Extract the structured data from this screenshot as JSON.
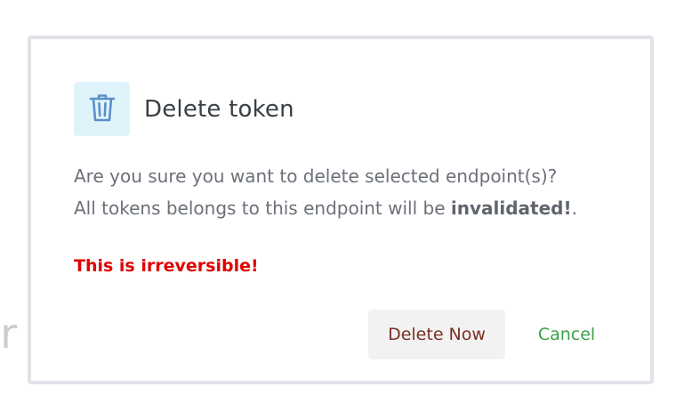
{
  "background": {
    "partial_text": "er"
  },
  "dialog": {
    "icon": "trash-icon",
    "title": "Delete token",
    "message_line1": "Are you sure you want to delete selected endpoint(s)?",
    "message_line2_prefix": "All tokens belongs to this endpoint will be ",
    "message_line2_bold": "invalidated!",
    "message_line2_suffix": ".",
    "warning": "This is irreversible!",
    "delete_button_label": "Delete Now",
    "cancel_button_label": "Cancel"
  },
  "colors": {
    "warning": "#e00000",
    "delete_text": "#7a2e22",
    "cancel_text": "#3aa24a",
    "icon_bg": "#dff4fa",
    "icon_stroke": "#5b8fc9",
    "frame_border": "#dfe3e8"
  }
}
